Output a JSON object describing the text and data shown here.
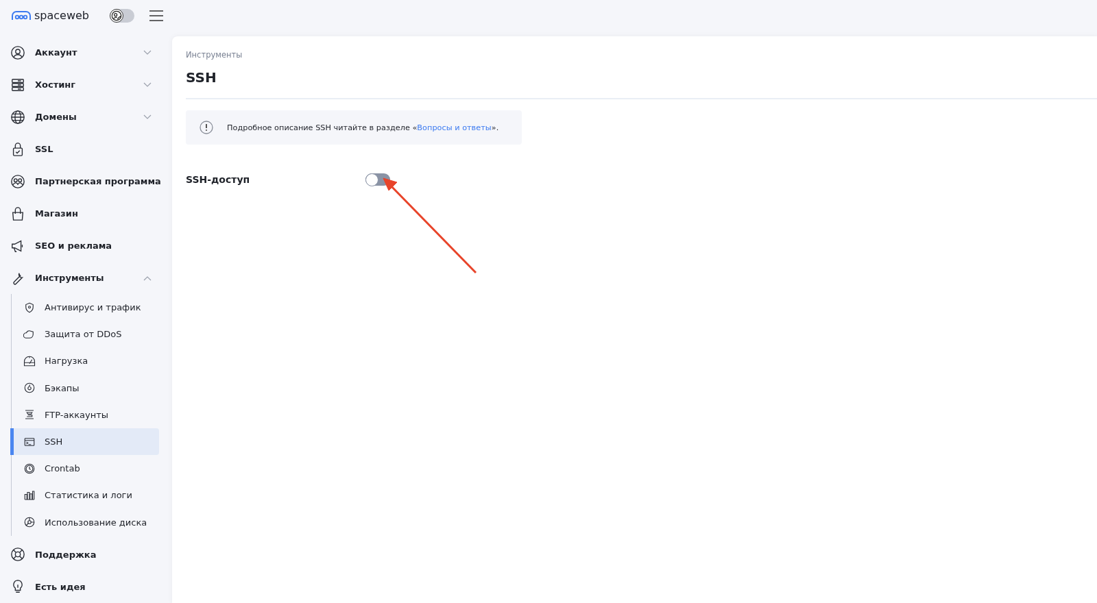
{
  "header": {
    "logo": "spaceweb",
    "theme_toggle": {
      "on": false
    }
  },
  "sidebar": {
    "items": [
      {
        "kind": "group",
        "label": "Аккаунт",
        "expanded": false
      },
      {
        "kind": "group",
        "label": "Хостинг",
        "expanded": false
      },
      {
        "kind": "group",
        "label": "Домены",
        "expanded": false
      },
      {
        "kind": "link",
        "label": "SSL"
      },
      {
        "kind": "link",
        "label": "Партнерская программа"
      },
      {
        "kind": "link",
        "label": "Магазин"
      },
      {
        "kind": "link",
        "label": "SEO и реклама"
      },
      {
        "kind": "group",
        "label": "Инструменты",
        "expanded": true,
        "children": [
          {
            "label": "Антивирус и трафик",
            "selected": false
          },
          {
            "label": "Защита от DDoS",
            "selected": false
          },
          {
            "label": "Нагрузка",
            "selected": false
          },
          {
            "label": "Бэкапы",
            "selected": false
          },
          {
            "label": "FTP-аккаунты",
            "selected": false
          },
          {
            "label": "SSH",
            "selected": true
          },
          {
            "label": "Crontab",
            "selected": false
          },
          {
            "label": "Статистика и логи",
            "selected": false
          },
          {
            "label": "Использование диска",
            "selected": false
          }
        ]
      },
      {
        "kind": "link",
        "label": "Поддержка"
      },
      {
        "kind": "link",
        "label": "Есть идея"
      }
    ]
  },
  "main": {
    "breadcrumb": "Инструменты",
    "title": "SSH",
    "notice": {
      "prefix": "Подробное описание SSH читайте в разделе «",
      "link": "Вопросы и ответы",
      "suffix": "»."
    },
    "setting": {
      "label": "SSH-доступ",
      "on": false
    }
  }
}
